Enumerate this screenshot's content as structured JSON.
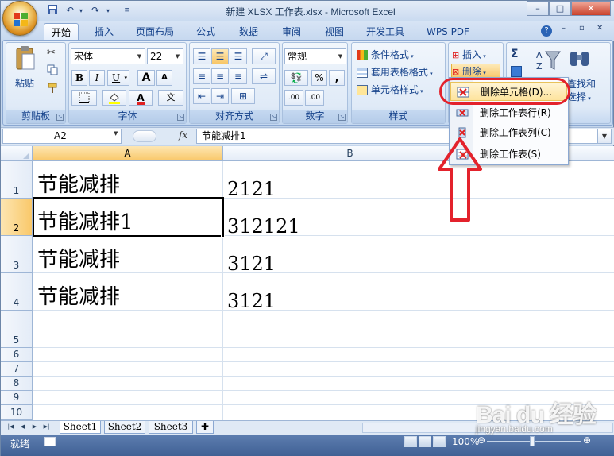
{
  "window": {
    "title": "新建 XLSX 工作表.xlsx - Microsoft Excel",
    "controls": {
      "minimize": "–",
      "restore": "□",
      "close": "✕"
    }
  },
  "ribbon_tabs": [
    {
      "label": "开始",
      "active": true
    },
    {
      "label": "插入"
    },
    {
      "label": "页面布局"
    },
    {
      "label": "公式"
    },
    {
      "label": "数据"
    },
    {
      "label": "审阅"
    },
    {
      "label": "视图"
    },
    {
      "label": "开发工具"
    },
    {
      "label": "WPS PDF"
    }
  ],
  "ribbon": {
    "clipboard": {
      "group_label": "剪贴板",
      "paste_label": "粘贴"
    },
    "font": {
      "group_label": "字体",
      "font_name": "宋体",
      "font_size": "22",
      "bold": "B",
      "italic": "I",
      "underline": "U",
      "grow": "A",
      "shrink": "A",
      "wen": "文"
    },
    "alignment": {
      "group_label": "对齐方式"
    },
    "number": {
      "group_label": "数字",
      "format": "常规",
      "percent": "%",
      "comma": ",",
      "inc_decimal": ".00",
      "dec_decimal": ".00"
    },
    "styles": {
      "group_label": "样式",
      "conditional": "条件格式",
      "table_format": "套用表格格式",
      "cell_styles": "单元格样式"
    },
    "cells": {
      "insert": "插入",
      "delete": "删除"
    },
    "editing": {
      "sigma": "Σ",
      "find_select_line1": "查找和",
      "find_select_line2": "选择"
    }
  },
  "formula_bar": {
    "name_box": "A2",
    "fx": "fx",
    "content": "节能减排1"
  },
  "columns": [
    "A",
    "B"
  ],
  "rows": [
    {
      "num": "1",
      "a": "节能减排",
      "b": "2121"
    },
    {
      "num": "2",
      "a": "节能减排1",
      "b": "312121"
    },
    {
      "num": "3",
      "a": "节能减排",
      "b": "3121"
    },
    {
      "num": "4",
      "a": "节能减排",
      "b": "3121"
    },
    {
      "num": "5"
    },
    {
      "num": "6"
    },
    {
      "num": "7"
    },
    {
      "num": "8"
    },
    {
      "num": "9"
    },
    {
      "num": "10"
    }
  ],
  "sheets": [
    "Sheet1",
    "Sheet2",
    "Sheet3"
  ],
  "status": {
    "mode": "就绪",
    "zoom": "100%"
  },
  "delete_menu": {
    "items": [
      {
        "label": "删除单元格(D)..."
      },
      {
        "label": "删除工作表行(R)"
      },
      {
        "label": "删除工作表列(C)"
      },
      {
        "label": "删除工作表(S)"
      }
    ]
  },
  "watermark": {
    "logo": "Bai du 经验",
    "url": "jingyan.baidu.com"
  },
  "colors": {
    "annotation": "#e3222c",
    "ribbon": "#dfeaf7",
    "selection": "#f9c86a"
  }
}
